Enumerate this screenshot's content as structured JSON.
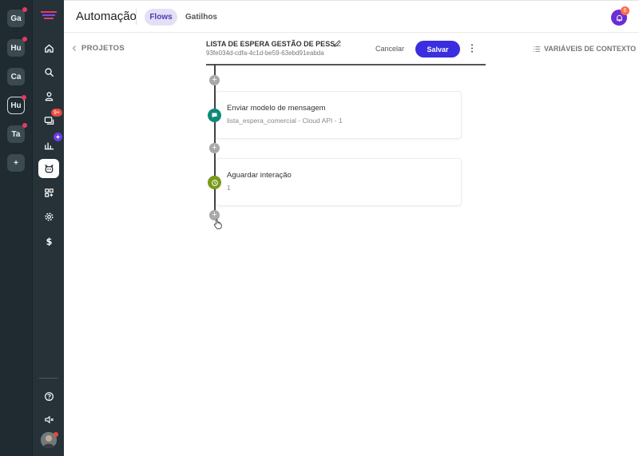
{
  "workspaces": [
    {
      "label": "Ga",
      "dot": true
    },
    {
      "label": "Hu",
      "dot": true
    },
    {
      "label": "Ca",
      "dot": false
    },
    {
      "label": "Hu",
      "dot": true,
      "active": true
    },
    {
      "label": "Ta",
      "dot": true
    },
    {
      "label": "+",
      "dot": false
    }
  ],
  "nav": {
    "chat_badge": "9+",
    "items": [
      "home-icon",
      "search-icon",
      "contacts-icon",
      "chat-icon",
      "reports-icon",
      "bot-icon",
      "apps-icon",
      "settings-icon",
      "billing-icon",
      "help-icon",
      "mute-icon"
    ]
  },
  "header": {
    "title": "Automação",
    "tabs": [
      {
        "label": "Flows",
        "active": true
      },
      {
        "label": "Gatilhos",
        "active": false
      }
    ],
    "notification_count": "6"
  },
  "subbar": {
    "back_label": "PROJETOS",
    "flow_name": "LISTA DE ESPERA GESTÃO DE PESS...",
    "flow_id": "93fe034d-cdfa-4c1d-be59-63ebd91eabda",
    "cancel_label": "Cancelar",
    "save_label": "Salvar",
    "context_label": "VARIÁVEIS DE CONTEXTO"
  },
  "flow": {
    "nodes": [
      {
        "title": "Enviar modelo de mensagem",
        "subtitle": "lista_espera_comercial - Cloud API - 1",
        "icon": "chat-bubble-icon",
        "color": "#0f8a7a"
      },
      {
        "title": "Aguardar interação",
        "subtitle": "1",
        "icon": "clock-icon",
        "color": "#7a9a1a"
      }
    ]
  },
  "colors": {
    "primary": "#3a2ee0",
    "sidebar_dark": "#263238",
    "rail_dark": "#1f2b30",
    "tab_active_bg": "#e3e0f6",
    "notification": "#6a2dd6"
  }
}
